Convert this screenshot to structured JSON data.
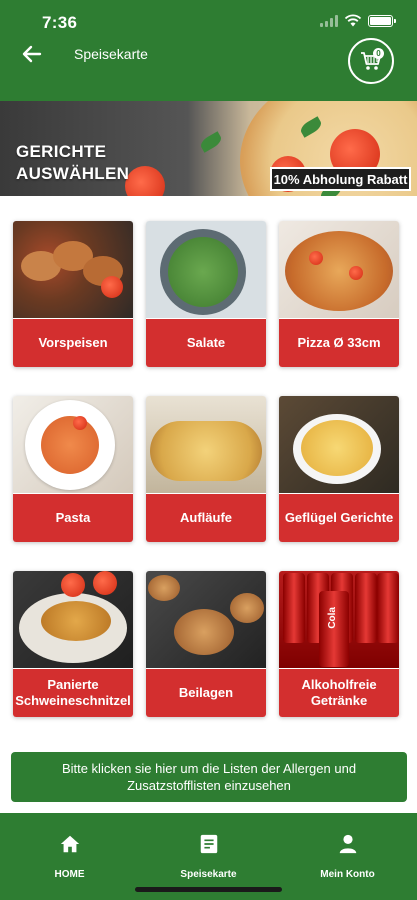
{
  "status_bar": {
    "time": "7:36"
  },
  "header": {
    "title": "Speisekarte",
    "cart_count": "0",
    "icons": {
      "back": "arrow-left-icon",
      "cart": "cart-icon"
    }
  },
  "banner": {
    "title_line1": "GERICHTE",
    "title_line2": "AUSWÄHLEN",
    "badge": "10% Abholung Rabatt"
  },
  "categories": [
    {
      "label": "Vorspeisen"
    },
    {
      "label": "Salate"
    },
    {
      "label": "Pizza Ø 33cm"
    },
    {
      "label": "Pasta"
    },
    {
      "label": "Aufläufe"
    },
    {
      "label": "Geflügel Gerichte"
    },
    {
      "label": "Panierte Schweineschnitzel"
    },
    {
      "label": "Beilagen"
    },
    {
      "label": "Alkoholfreie Getränke"
    }
  ],
  "can_label": "Cola",
  "info_button": {
    "text": "Bitte klicken sie hier um die Listen der Allergen und Zusatzstofflisten einzusehen"
  },
  "bottom_nav": [
    {
      "label": "HOME",
      "icon": "home-icon"
    },
    {
      "label": "Speisekarte",
      "icon": "menu-icon"
    },
    {
      "label": "Mein Konto",
      "icon": "user-icon"
    }
  ],
  "colors": {
    "primary_green": "#2e7d32",
    "category_red": "#d32f2f",
    "white": "#ffffff"
  }
}
